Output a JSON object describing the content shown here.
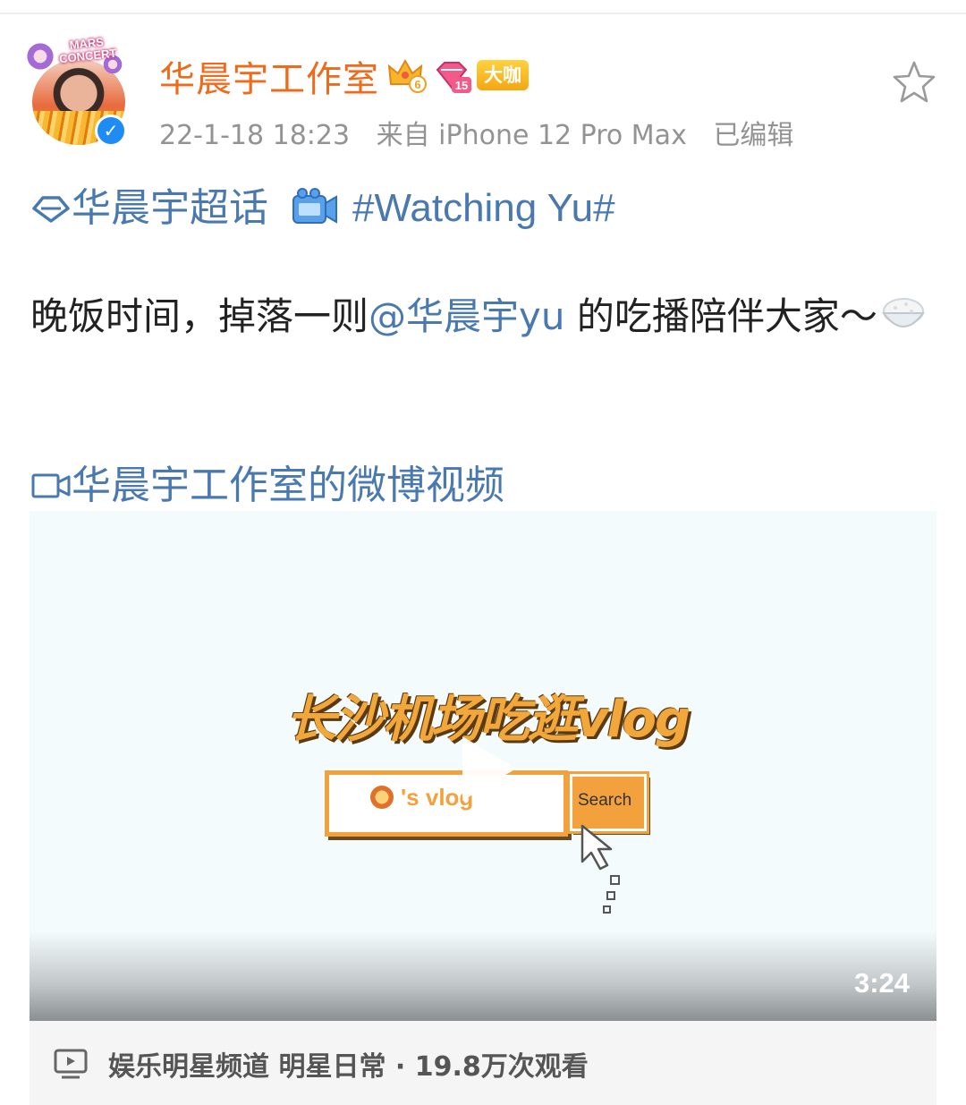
{
  "post": {
    "username": "华晨宇工作室",
    "badges": {
      "crown_level": "6",
      "diamond_level": "15",
      "vip_label": "大咖"
    },
    "avatar_banner": "MARS CONCERT",
    "timestamp": "22-1-18 18:23",
    "source": "来自 iPhone 12 Pro Max",
    "edited": "已编辑",
    "topic": "华晨宇超话",
    "hashtag": "#Watching Yu#",
    "text_before": "晚饭时间，掉落一则",
    "mention": "@华晨宇yu",
    "text_after": " 的吃播陪伴大家～",
    "video_link": "华晨宇工作室的微博视频"
  },
  "video": {
    "title_overlay": "长沙机场吃逛vlog",
    "search_box_text": "'s vlog",
    "search_button": "Search",
    "duration": "3:24",
    "info": "娱乐明星频道 明星日常 · 19.8万次观看"
  },
  "colors": {
    "username": "#f06a1c",
    "link": "#4a79b0",
    "meta": "#939393",
    "vip_badge": "#f3a712",
    "verified": "#1f8bf5",
    "video_accent": "#f3a13c"
  },
  "icons": {
    "favorite": "star-outline-icon",
    "topic": "diamond-icon",
    "hashtag": "video-camera-icon",
    "video_link": "camera-outline-icon",
    "channel": "tv-icon",
    "emoji": "rice-bowl-icon"
  }
}
